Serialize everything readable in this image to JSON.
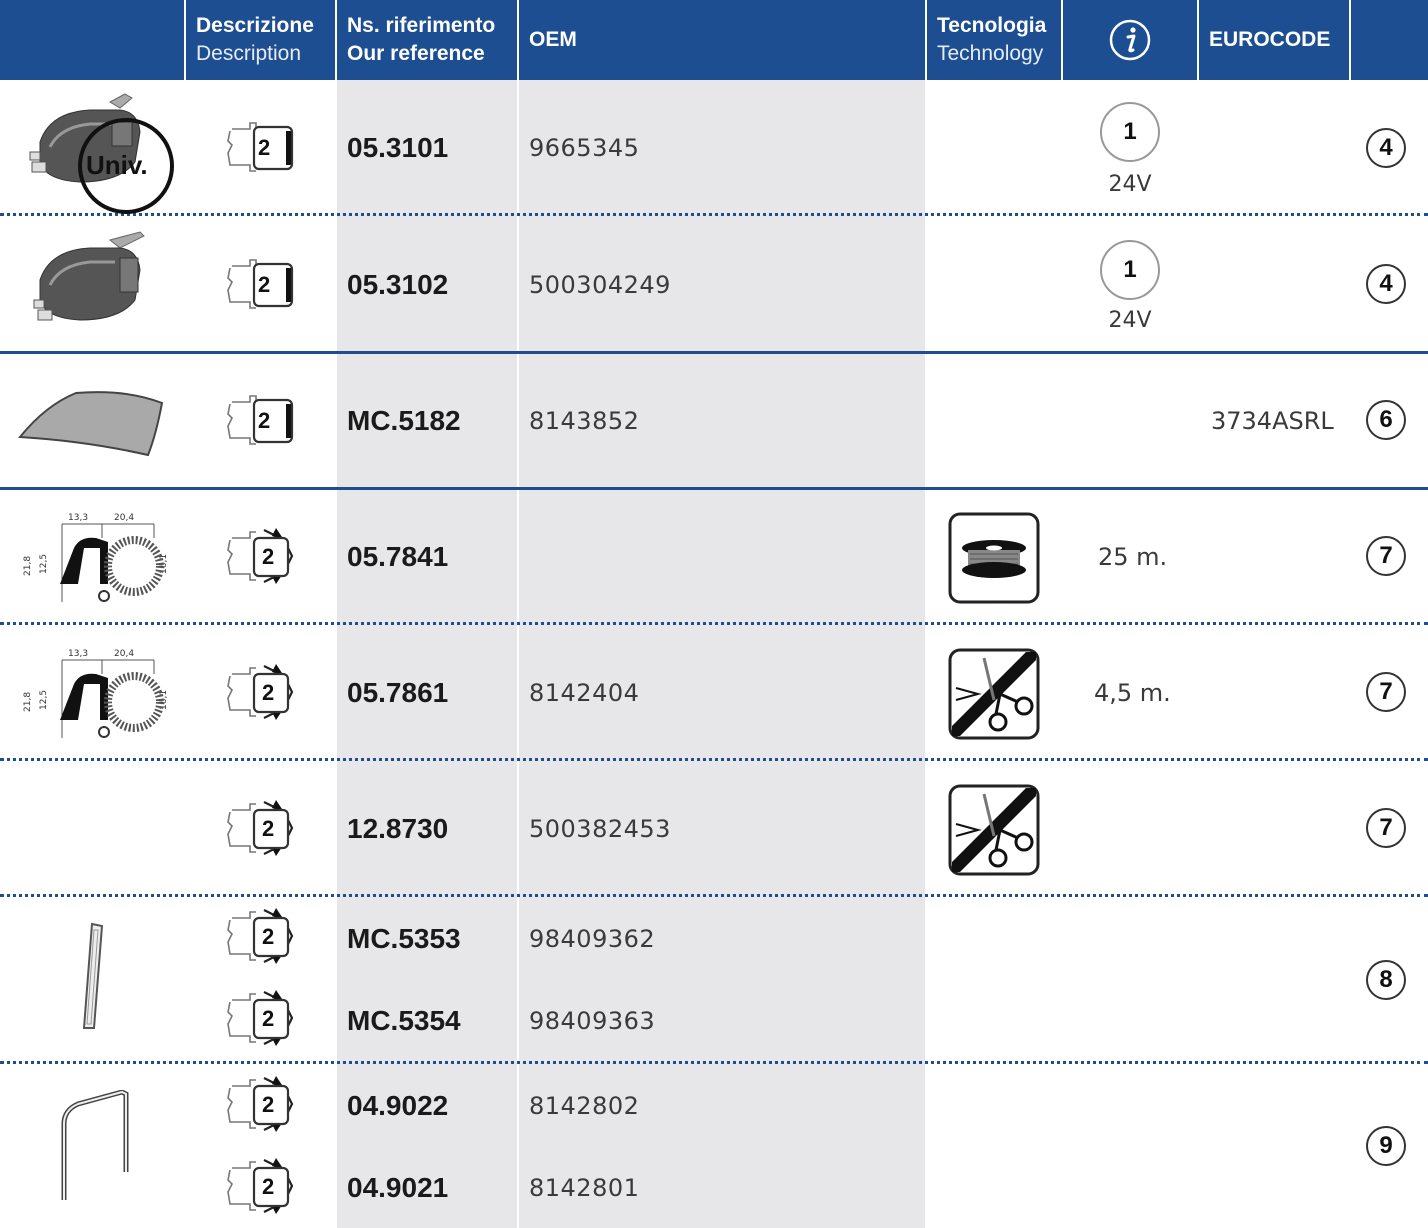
{
  "header": {
    "desc_it": "Descrizione",
    "desc_en": "Description",
    "ref_it": "Ns. riferimento",
    "ref_en": "Our reference",
    "oem": "OEM",
    "tech_it": "Tecnologia",
    "tech_en": "Technology",
    "info_icon": "info-icon",
    "eurocode": "EUROCODE"
  },
  "colors": {
    "header_bg": "#1d4e92",
    "ref_col_bg": "#e7e7e9"
  },
  "rows": [
    {
      "ref": "05.3101",
      "oem": "9665345",
      "info_circle": "1",
      "voltage": "24V",
      "badge": "4",
      "image": "washer-pump-icon",
      "note": "Univ."
    },
    {
      "ref": "05.3102",
      "oem": "500304249",
      "info_circle": "1",
      "voltage": "24V",
      "badge": "4",
      "image": "washer-pump-icon"
    },
    {
      "ref": "MC.5182",
      "oem": "8143852",
      "eurocode": "3734ASRL",
      "badge": "6",
      "image": "windscreen-icon"
    },
    {
      "ref": "05.7841",
      "oem": "",
      "tech": "spool-icon",
      "info_text": "25 m.",
      "badge": "7",
      "image": "seal-profile-icon"
    },
    {
      "ref": "05.7861",
      "oem": "8142404",
      "tech": "scissors-cut-icon",
      "info_text": "4,5 m.",
      "badge": "7",
      "image": "seal-profile-icon"
    },
    {
      "ref": "12.8730",
      "oem": "500382453",
      "tech": "scissors-cut-icon",
      "badge": "7"
    },
    {
      "ref": "MC.5353",
      "oem": "98409362",
      "badge": "8",
      "image": "strip-icon"
    },
    {
      "ref": "MC.5354",
      "oem": "98409363"
    },
    {
      "ref": "04.9022",
      "oem": "8142802",
      "badge": "9",
      "image": "bracket-icon"
    },
    {
      "ref": "04.9021",
      "oem": "8142801"
    }
  ],
  "package_label": "2",
  "seal_dims": {
    "d1": "13,3",
    "d2": "20,4",
    "h1": "21,8",
    "h2": "12,5",
    "h3": "16,1"
  }
}
